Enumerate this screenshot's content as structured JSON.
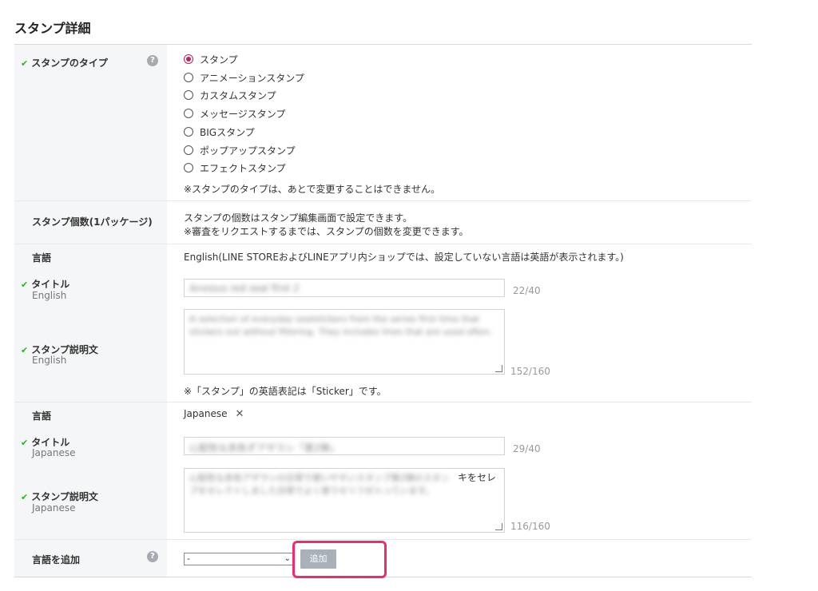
{
  "page": {
    "title": "スタンプ詳細"
  },
  "type_row": {
    "label": "スタンプのタイプ",
    "options": [
      {
        "label": "スタンプ",
        "selected": true
      },
      {
        "label": "アニメーションスタンプ",
        "selected": false
      },
      {
        "label": "カスタムスタンプ",
        "selected": false
      },
      {
        "label": "メッセージスタンプ",
        "selected": false
      },
      {
        "label": "BIGスタンプ",
        "selected": false
      },
      {
        "label": "ポップアップスタンプ",
        "selected": false
      },
      {
        "label": "エフェクトスタンプ",
        "selected": false
      }
    ],
    "note": "※スタンプのタイプは、あとで変更することはできません。"
  },
  "count_row": {
    "label": "スタンプ個数(1パッケージ)",
    "line1": "スタンプの個数はスタンプ編集画面で設定できます。",
    "line2": "※審査をリクエストするまでは、スタンプの個数を変更できます。"
  },
  "english": {
    "language_label": "言語",
    "language_value": "English(LINE STOREおよびLINEアプリ内ショップでは、設定していない言語は英語が表示されます。)",
    "title_label": "タイトル",
    "title_sub": "English",
    "title_value": "Anxious red seal first 2",
    "title_counter": "22/40",
    "desc_label": "スタンプ説明文",
    "desc_sub": "English",
    "desc_value": "A selection of everyday sealstickers from the series first time that stickers out without filtering. They includes lines that are used often.",
    "desc_counter": "152/160",
    "note": "※「スタンプ」の英語表記は「Sticker」です。"
  },
  "japanese": {
    "language_label": "言語",
    "language_value": "Japanese",
    "title_label": "タイトル",
    "title_sub": "Japanese",
    "title_value": "心配性な赤色ずアザラシ「第2弾」",
    "title_counter": "29/40",
    "desc_label": "スタンプ説明文",
    "desc_sub": "Japanese",
    "desc_value": "心配性な赤色アザラシの日常で使いやすいスタンプ第2弾のスタンプをセレクトしました日常でよく使うセリフが入っています。",
    "desc_visible_tail": "キをセレ",
    "desc_counter": "116/160"
  },
  "add_language": {
    "label": "言語を追加",
    "select_value": "-",
    "button_label": "追加"
  },
  "colors": {
    "check": "#27b427",
    "radio_selected": "#b8245b",
    "highlight": "#ee2b6c",
    "button": "#a9b0b8"
  }
}
